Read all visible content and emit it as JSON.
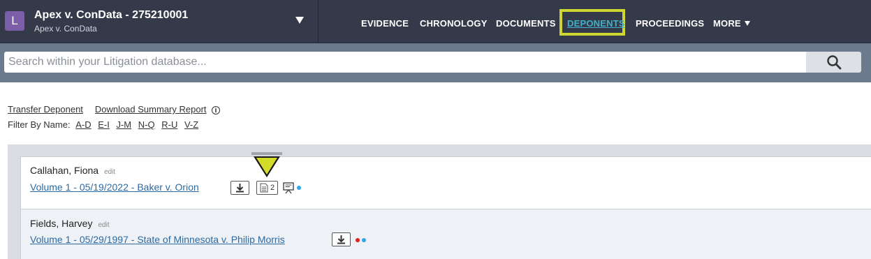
{
  "case": {
    "avatar_letter": "L",
    "title": "Apex v. ConData - 275210001",
    "subtitle": "Apex v. ConData"
  },
  "nav": {
    "items": [
      "EVIDENCE",
      "CHRONOLOGY",
      "DOCUMENTS",
      "DEPONENTS",
      "PROCEEDINGS"
    ],
    "more_label": "MORE",
    "active": "DEPONENTS"
  },
  "search": {
    "placeholder": "Search within your Litigation database..."
  },
  "actions": {
    "transfer": "Transfer Deponent",
    "download": "Download Summary Report"
  },
  "filter": {
    "label": "Filter By Name:",
    "ranges": [
      "A-D",
      "E-I",
      "J-M",
      "N-Q",
      "R-U",
      "V-Z"
    ]
  },
  "deponents": [
    {
      "name": "Callahan, Fiona",
      "edit": "edit",
      "volume": "Volume 1 - 05/19/2022 - Baker v. Orion",
      "doc_count": "2",
      "dots": [
        "#2aa8e8"
      ]
    },
    {
      "name": "Fields, Harvey",
      "edit": "edit",
      "volume": "Volume 1 - 05/29/1997 - State of Minnesota v. Philip Morris",
      "dots": [
        "#e02020",
        "#2aa8e8"
      ]
    }
  ],
  "colors": {
    "topbar": "#343a4a",
    "highlight": "#cfd632",
    "active_link": "#3fb1c9",
    "link": "#2c6aa0"
  },
  "icons": {
    "search": "magnifier-icon",
    "download": "download-icon",
    "document": "document-icon",
    "presentation": "presentation-icon",
    "pointer": "yellow-triangle-pointer"
  }
}
